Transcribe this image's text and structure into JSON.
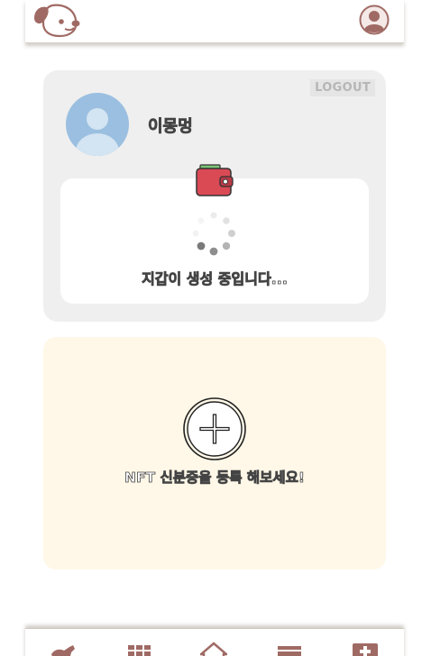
{
  "header": {
    "logo_icon": "dog-logo-icon",
    "profile_icon": "user-profile-icon"
  },
  "profile": {
    "logout_label": "LOGOUT",
    "user_name": "이몽멍",
    "avatar_icon": "default-avatar-icon"
  },
  "wallet": {
    "icon": "wallet-icon",
    "status_text": "지갑이 생성 중입니다..."
  },
  "nft": {
    "add_icon": "plus-circle-icon",
    "prompt_text": "NFT 신분증을 등록 해보세요!"
  },
  "bottom_nav": {
    "items": [
      "pet-walk-icon",
      "grid-icon",
      "home-icon",
      "calendar-icon",
      "medical-cross-icon"
    ]
  },
  "colors": {
    "brand": "#a06a64",
    "avatar_bg": "#9bbfe0",
    "card_bg": "#efefef",
    "nft_bg": "#fff8e8",
    "wallet_red": "#d94a55"
  }
}
